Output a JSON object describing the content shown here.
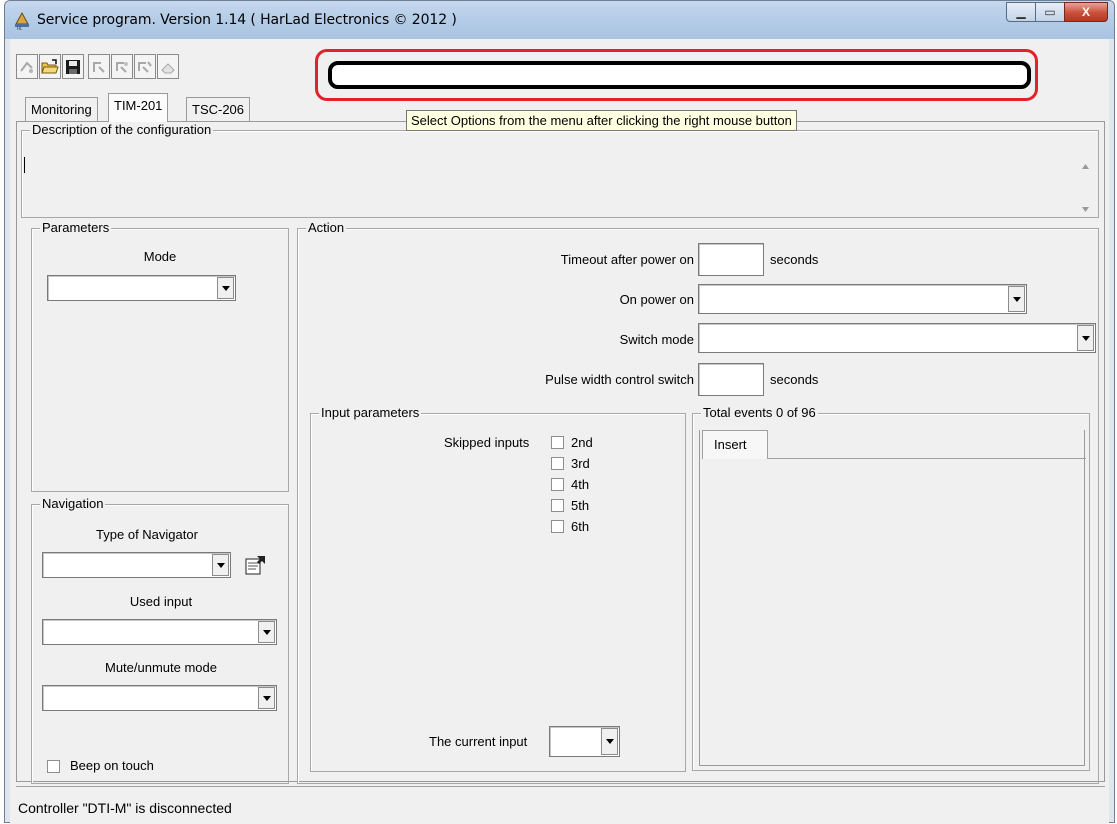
{
  "window": {
    "title": "Service program. Version 1.14 ( HarLad Electronics © 2012 )",
    "minimize_glyph": "▁",
    "maximize_glyph": "▭",
    "close_glyph": "X"
  },
  "toolbar": {
    "buttons": [
      "connect-icon",
      "open-folder-icon",
      "save-disk-icon",
      "read-icon",
      "write-icon",
      "verify-icon",
      "erase-icon"
    ]
  },
  "message_bar": {
    "value": ""
  },
  "tooltip": "Select Options from the menu after clicking the right mouse button",
  "tabs": [
    {
      "label": "Monitoring",
      "active": false
    },
    {
      "label": "TIM-201",
      "active": true
    },
    {
      "label": "TSC-206",
      "active": false
    }
  ],
  "description": {
    "legend": "Description of the configuration",
    "value": ""
  },
  "parameters": {
    "legend": "Parameters",
    "mode_label": "Mode",
    "mode_value": ""
  },
  "navigation": {
    "legend": "Navigation",
    "type_label": "Type of Navigator",
    "type_value": "",
    "used_input_label": "Used input",
    "used_input_value": "",
    "mute_label": "Mute/unmute mode",
    "mute_value": "",
    "beep_label": "Beep on touch",
    "beep_checked": false
  },
  "action": {
    "legend": "Action",
    "timeout_label": "Timeout after power on",
    "timeout_value": "",
    "timeout_unit": "seconds",
    "power_on_label": "On power on",
    "power_on_value": "",
    "switch_mode_label": "Switch mode",
    "switch_mode_value": "",
    "pulse_label": "Pulse width control switch",
    "pulse_value": "",
    "pulse_unit": "seconds"
  },
  "input_parameters": {
    "legend": "Input parameters",
    "skipped_label": "Skipped inputs",
    "inputs": [
      "2nd",
      "3rd",
      "4th",
      "5th",
      "6th"
    ],
    "current_input_label": "The current input",
    "current_input_value": ""
  },
  "events": {
    "legend": "Total events 0 of 96",
    "tab_label": "Insert"
  },
  "status": {
    "text": "Controller \"DTI-M\" is disconnected"
  },
  "colors": {
    "highlight": "#e2222b",
    "tooltip_bg": "#ffffe1",
    "titlebar": "#b3cbe6"
  }
}
